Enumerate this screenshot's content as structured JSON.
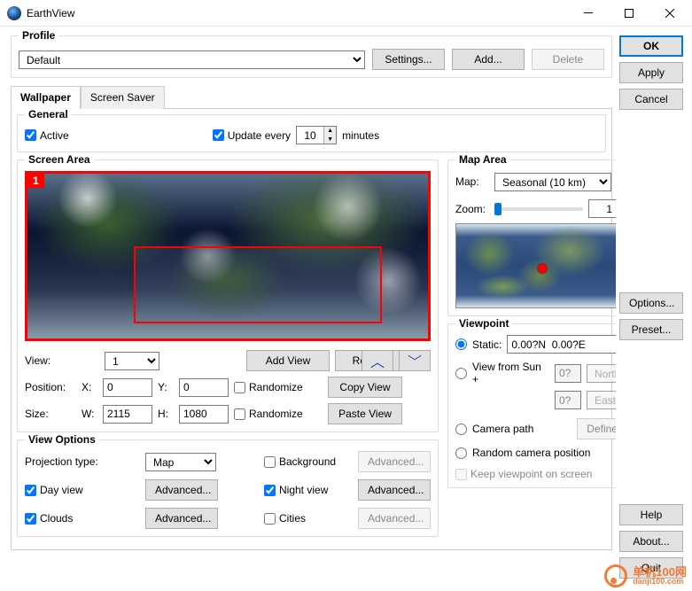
{
  "window": {
    "title": "EarthView"
  },
  "profile": {
    "legend": "Profile",
    "selected": "Default",
    "settings_btn": "Settings...",
    "add_btn": "Add...",
    "delete_btn": "Delete"
  },
  "right_buttons": {
    "ok": "OK",
    "apply": "Apply",
    "cancel": "Cancel",
    "options": "Options...",
    "preset": "Preset...",
    "help": "Help",
    "about": "About...",
    "quit": "Quit"
  },
  "tabs": {
    "wallpaper": "Wallpaper",
    "screensaver": "Screen Saver"
  },
  "general": {
    "legend": "General",
    "active": "Active",
    "update_every": "Update every",
    "update_value": "10",
    "minutes": "minutes"
  },
  "screen_area": {
    "legend": "Screen Area",
    "badge": "1",
    "view_label": "View:",
    "view_value": "1",
    "add_view": "Add View",
    "remove": "Remove",
    "position_label": "Position:",
    "x_label": "X:",
    "x_value": "0",
    "y_label": "Y:",
    "y_value": "0",
    "randomize": "Randomize",
    "copy_view": "Copy View",
    "size_label": "Size:",
    "w_label": "W:",
    "w_value": "2115",
    "h_label": "H:",
    "h_value": "1080",
    "paste_view": "Paste View"
  },
  "map_area": {
    "legend": "Map Area",
    "map_label": "Map:",
    "map_value": "Seasonal (10 km)",
    "plus": "+",
    "zoom_label": "Zoom:",
    "zoom_value": "1",
    "zoom_unit": "%"
  },
  "viewpoint": {
    "legend": "Viewpoint",
    "static": "Static:",
    "static_value": "0.00?N  0.00?E",
    "view_from_sun": "View from Sun +",
    "sun_deg1": "0?",
    "sun_dir1": "North",
    "sun_deg2": "0?",
    "sun_dir2": "East",
    "camera_path": "Camera path",
    "define": "Define...",
    "random_camera": "Random camera position",
    "keep_viewpoint": "Keep viewpoint on screen"
  },
  "view_options": {
    "legend": "View Options",
    "projection_type": "Projection type:",
    "projection_value": "Map",
    "background": "Background",
    "advanced": "Advanced...",
    "day_view": "Day view",
    "night_view": "Night view",
    "clouds": "Clouds",
    "cities": "Cities"
  },
  "watermark": {
    "brand": "单机100网",
    "url": "danji100.com"
  }
}
